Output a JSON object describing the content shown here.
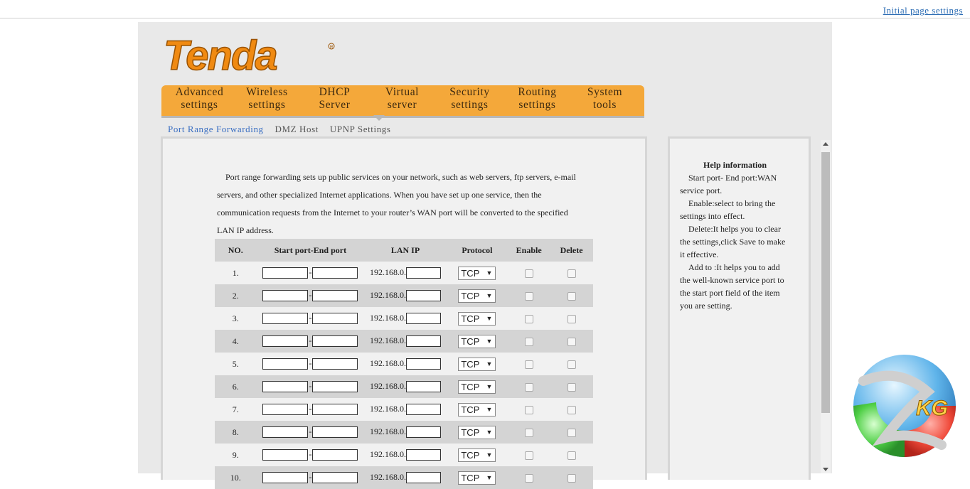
{
  "top": {
    "initial_settings_link": "Initial page settings"
  },
  "brand": {
    "logo_text": "Tenda"
  },
  "nav": [
    {
      "line1": "Advanced",
      "line2": "settings"
    },
    {
      "line1": "Wireless",
      "line2": "settings"
    },
    {
      "line1": "DHCP",
      "line2": "Server"
    },
    {
      "line1": "Virtual",
      "line2": "server"
    },
    {
      "line1": "Security",
      "line2": "settings"
    },
    {
      "line1": "Routing",
      "line2": "settings"
    },
    {
      "line1": "System",
      "line2": "tools"
    }
  ],
  "subnav": [
    "Port Range Forwarding",
    "DMZ Host",
    "UPNP Settings"
  ],
  "description": {
    "line1": "Port range forwarding sets up public services on your network, such as web servers, ftp servers, e-mail",
    "line2": "servers, and other specialized Internet applications. When you have set up one service, then the",
    "line3": "communication requests from the Internet to your router’s WAN port will be converted to the specified",
    "line4": "LAN IP address."
  },
  "table": {
    "headers": [
      "NO.",
      "Start port-End port",
      "LAN IP",
      "Protocol",
      "Enable",
      "Delete"
    ],
    "ip_prefix": "192.168.0.",
    "protocol_value": "TCP",
    "rows": [
      "1.",
      "2.",
      "3.",
      "4.",
      "5.",
      "6.",
      "7.",
      "8.",
      "9.",
      "10."
    ]
  },
  "help": {
    "title": "Help information",
    "p1": "Start port- End port:WAN service port.",
    "p2": "Enable:select to bring the settings into effect.",
    "p3": "Delete:It helps you to clear the settings,click Save to make it effective.",
    "p4": "Add to :It helps you to add the well-known service port to the start port field of the item you are setting."
  },
  "watermark": {
    "text": "KG"
  },
  "colors": {
    "nav_orange": "#f4a83a",
    "logo_orange": "#f08a12",
    "link_blue": "#2a6bb3",
    "row_gray": "#d4d4d4"
  }
}
